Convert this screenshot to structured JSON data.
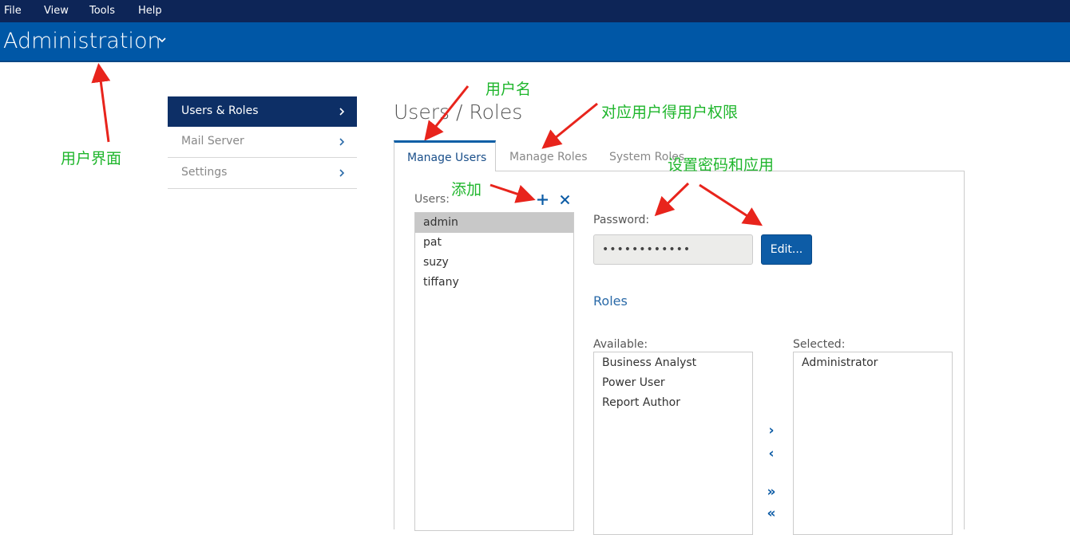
{
  "menu": {
    "items": [
      "File",
      "View",
      "Tools",
      "Help"
    ]
  },
  "header": {
    "title": "Administration"
  },
  "sidenav": {
    "items": [
      {
        "label": "Users & Roles",
        "active": true
      },
      {
        "label": "Mail Server",
        "active": false
      },
      {
        "label": "Settings",
        "active": false
      }
    ]
  },
  "page": {
    "title": "Users / Roles"
  },
  "tabs": [
    "Manage Users",
    "Manage Roles",
    "System Roles"
  ],
  "users": {
    "label": "Users:",
    "items": [
      "admin",
      "pat",
      "suzy",
      "tiffany"
    ],
    "selected": "admin"
  },
  "password": {
    "label": "Password:",
    "value": "••••••••••••",
    "edit_label": "Edit..."
  },
  "roles": {
    "title": "Roles",
    "available_label": "Available:",
    "selected_label": "Selected:",
    "available": [
      "Business Analyst",
      "Power User",
      "Report Author"
    ],
    "selected": [
      "Administrator"
    ],
    "move_buttons": [
      "›",
      "‹",
      "»",
      "«"
    ]
  },
  "annotations": {
    "user_interface": "用户界面",
    "username": "用户名",
    "role_permissions": "对应用户得用户权限",
    "add": "添加",
    "set_password": "设置密码和应用"
  },
  "colors": {
    "menubar": "#0d2557",
    "header": "#0057a6",
    "accent": "#0d5ca6",
    "annotation": "#1fb62c",
    "arrow": "#e8241c"
  }
}
